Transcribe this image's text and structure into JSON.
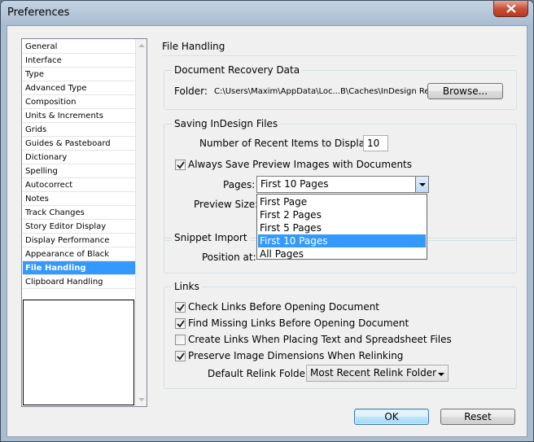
{
  "window": {
    "title": "Preferences"
  },
  "categories": [
    "General",
    "Interface",
    "Type",
    "Advanced Type",
    "Composition",
    "Units & Increments",
    "Grids",
    "Guides & Pasteboard",
    "Dictionary",
    "Spelling",
    "Autocorrect",
    "Notes",
    "Track Changes",
    "Story Editor Display",
    "Display Performance",
    "Appearance of Black",
    "File Handling",
    "Clipboard Handling"
  ],
  "selected_category": "File Handling",
  "panel": {
    "title": "File Handling",
    "recovery": {
      "group_label": "Document Recovery Data",
      "folder_label": "Folder:",
      "folder_path": "C:\\Users\\Maxim\\AppData\\Loc...B\\Caches\\InDesign Recovery",
      "browse_label": "Browse..."
    },
    "saving": {
      "group_label": "Saving InDesign Files",
      "recent_label": "Number of Recent Items to Display:",
      "recent_value": "10",
      "always_save_label": "Always Save Preview Images with Documents",
      "always_save_checked": true,
      "pages_label": "Pages:",
      "pages_value": "First 10 Pages",
      "preview_size_label": "Preview Size:",
      "pages_options": [
        "First Page",
        "First 2 Pages",
        "First 5 Pages",
        "First 10 Pages",
        "All Pages"
      ],
      "pages_selected_index": 3
    },
    "snippet": {
      "group_label": "Snippet Import",
      "position_label": "Position at:"
    },
    "links": {
      "group_label": "Links",
      "check_links_label": "Check Links Before Opening Document",
      "check_links_checked": true,
      "find_missing_label": "Find Missing Links Before Opening Document",
      "find_missing_checked": true,
      "create_links_label": "Create Links When Placing Text and Spreadsheet Files",
      "create_links_checked": false,
      "preserve_label": "Preserve Image Dimensions When Relinking",
      "preserve_checked": true,
      "relink_folder_label": "Default Relink Folder:",
      "relink_folder_value": "Most Recent Relink Folder"
    }
  },
  "footer": {
    "ok_label": "OK",
    "reset_label": "Reset"
  }
}
